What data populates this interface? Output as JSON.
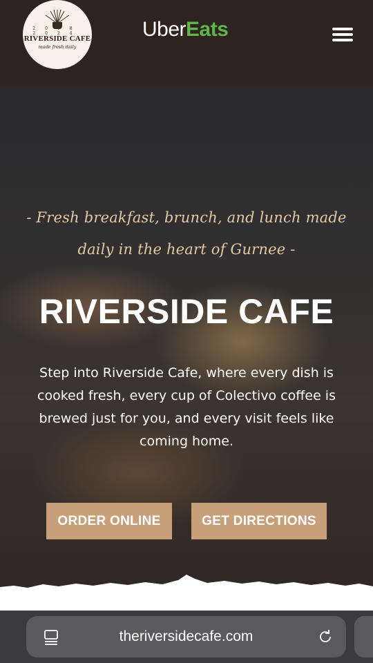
{
  "header": {
    "logo": {
      "name": "RIVERSIDE CAFE",
      "tagline": "made fresh daily",
      "years": "2018  2024",
      "icon": "coffee-cup-icon"
    },
    "brand": {
      "part1": "Uber",
      "part2": "Eats",
      "accent_color": "#5fb64a"
    },
    "menu_icon": "hamburger-menu-icon"
  },
  "hero": {
    "tagline": "- Fresh breakfast, brunch, and lunch made daily in the heart of Gurnee -",
    "title": "RIVERSIDE CAFE",
    "description": "Step into Riverside Cafe, where every dish is cooked fresh, every cup of Colectivo coffee is brewed just for you, and every visit feels like coming home.",
    "buttons": {
      "order_label": "ORDER ONLINE",
      "directions_label": "GET DIRECTIONS",
      "color": "#c7a07a"
    }
  },
  "browser": {
    "url": "theriversidecafe.com",
    "reader_icon": "reader-mode-icon",
    "reload_icon": "reload-icon"
  }
}
